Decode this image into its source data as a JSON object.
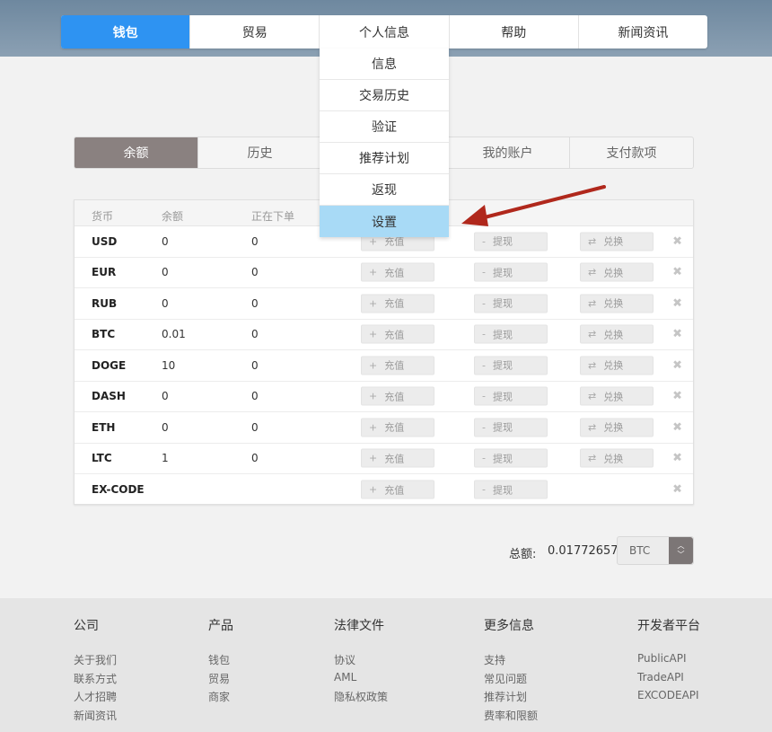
{
  "nav": {
    "items": [
      "钱包",
      "贸易",
      "个人信息",
      "帮助",
      "新闻资讯"
    ]
  },
  "dropdown": {
    "items": [
      "信息",
      "交易历史",
      "验证",
      "推荐计划",
      "返现",
      "设置"
    ]
  },
  "subtabs": {
    "items": [
      "余额",
      "历史",
      "",
      "我的账户",
      "支付款项"
    ]
  },
  "table": {
    "headers": [
      "货币",
      "余额",
      "正在下单"
    ],
    "deposit_label": "充值",
    "withdraw_label": "提现",
    "exchange_label": "兑换",
    "rows": [
      {
        "currency": "USD",
        "balance": "0",
        "orders": "0"
      },
      {
        "currency": "EUR",
        "balance": "0",
        "orders": "0"
      },
      {
        "currency": "RUB",
        "balance": "0",
        "orders": "0"
      },
      {
        "currency": "BTC",
        "balance": "0.01",
        "orders": "0"
      },
      {
        "currency": "DOGE",
        "balance": "10",
        "orders": "0"
      },
      {
        "currency": "DASH",
        "balance": "0",
        "orders": "0"
      },
      {
        "currency": "ETH",
        "balance": "0",
        "orders": "0"
      },
      {
        "currency": "LTC",
        "balance": "1",
        "orders": "0"
      },
      {
        "currency": "EX-CODE",
        "balance": "",
        "orders": ""
      }
    ]
  },
  "total": {
    "label": "总额:",
    "value": "0.01772657",
    "currency": "BTC"
  },
  "footer": {
    "company": {
      "title": "公司",
      "links": [
        "关于我们",
        "联系方式",
        "人才招聘",
        "新闻资讯"
      ]
    },
    "products": {
      "title": "产品",
      "links": [
        "钱包",
        "贸易",
        "商家"
      ]
    },
    "legal": {
      "title": "法律文件",
      "links": [
        "协议",
        "AML",
        "隐私权政策"
      ]
    },
    "more": {
      "title": "更多信息",
      "links": [
        "支持",
        "常见问题",
        "推荐计划",
        "费率和限额"
      ]
    },
    "dev": {
      "title": "开发者平台",
      "links": [
        {
          "name": "Public",
          "suffix": "API"
        },
        {
          "name": "Trade",
          "suffix": "API"
        },
        {
          "name": "EXCODE",
          "suffix": "API"
        }
      ]
    }
  },
  "colors": {
    "nav_active": "#2e93f2",
    "dropdown_highlight": "#a8daf6",
    "subtab_active": "#8a8180",
    "arrow": "#b0281c"
  }
}
